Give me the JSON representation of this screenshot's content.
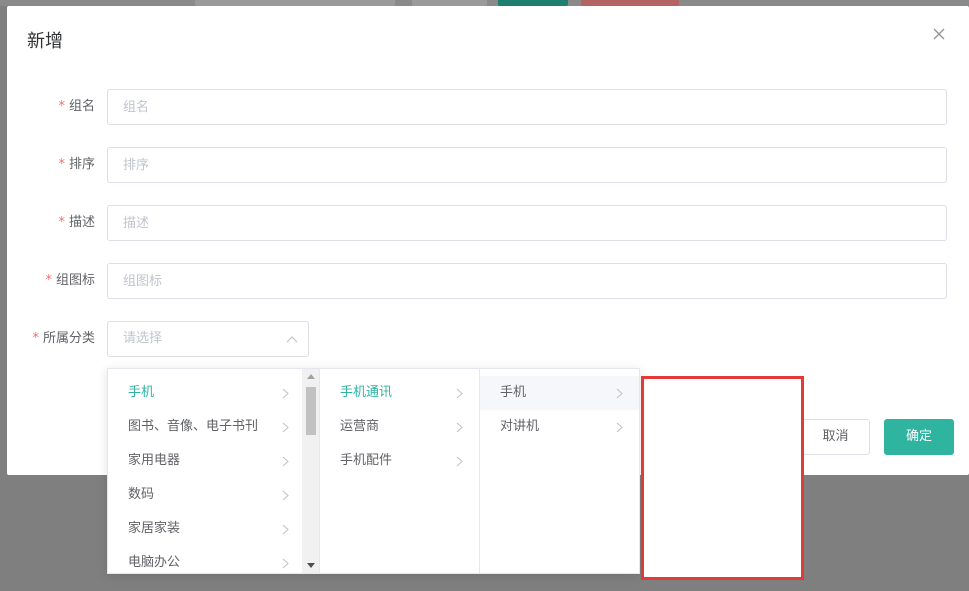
{
  "dialog": {
    "title": "新增",
    "close_icon": "close-icon"
  },
  "form": {
    "required_mark": "*",
    "fields": [
      {
        "label": "组名",
        "placeholder": "组名"
      },
      {
        "label": "排序",
        "placeholder": "排序"
      },
      {
        "label": "描述",
        "placeholder": "描述"
      },
      {
        "label": "组图标",
        "placeholder": "组图标"
      }
    ],
    "category": {
      "label": "所属分类",
      "placeholder": "请选择"
    }
  },
  "cascader": {
    "level1": [
      "手机",
      "图书、音像、电子书刊",
      "家用电器",
      "数码",
      "家居家装",
      "电脑办公"
    ],
    "level2": [
      "手机通讯",
      "运营商",
      "手机配件"
    ],
    "level3": [
      "手机",
      "对讲机"
    ]
  },
  "buttons": {
    "cancel": "取消",
    "confirm": "确定"
  },
  "colors": {
    "accent": "#2fb4a0",
    "required": "#f56c6c",
    "highlight": "#e53935"
  }
}
